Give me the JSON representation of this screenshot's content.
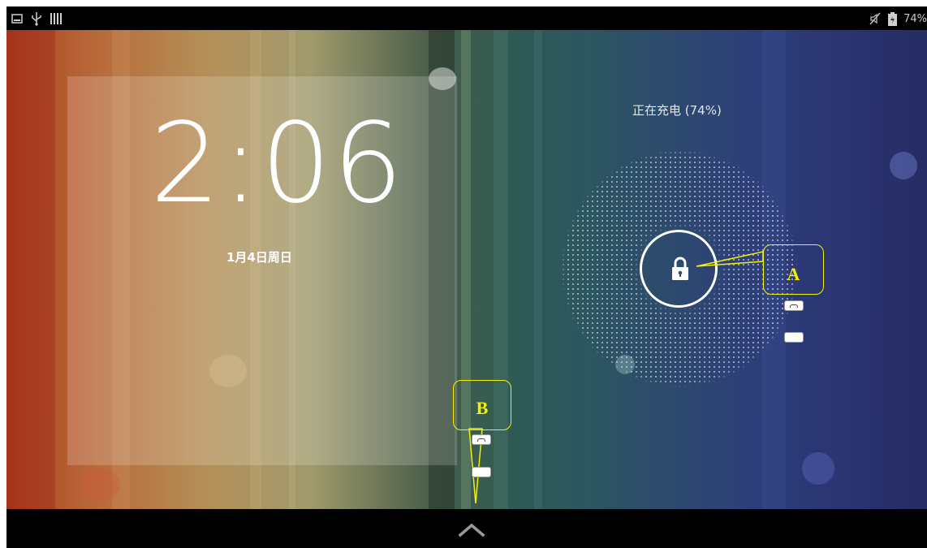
{
  "status_bar": {
    "left_icons": [
      "picture-icon",
      "usb-icon",
      "signal-bars-icon"
    ],
    "right_icons": [
      "muted-icon",
      "battery-icon"
    ],
    "battery_text": "74%"
  },
  "lockscreen": {
    "clock": "2:06",
    "date": "1月4日周日",
    "charging_status": "正在充电 (74%)",
    "unlock_icon": "lock-icon"
  },
  "nav_bar": {
    "icon": "chevron-up-icon"
  },
  "annotations": {
    "callout_a": "A",
    "callout_b": "B",
    "callout_color": "#f2f200"
  }
}
